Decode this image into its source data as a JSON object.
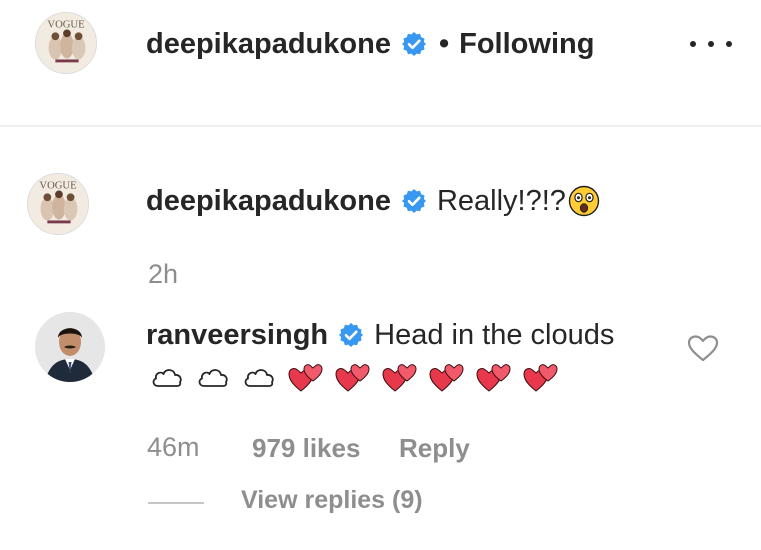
{
  "header": {
    "username": "deepikapadukone",
    "separator": "•",
    "follow_status": "Following",
    "avatar_caption": "VOGUE"
  },
  "comments": [
    {
      "username": "deepikapadukone",
      "text": "Really!?!?",
      "emoji": "astonished-face",
      "time": "2h",
      "avatar_caption": "VOGUE"
    },
    {
      "username": "ranveersingh",
      "text": "Head in the clouds",
      "emoji_row": [
        "cloud",
        "cloud",
        "cloud",
        "two-hearts",
        "two-hearts",
        "two-hearts",
        "two-hearts",
        "two-hearts",
        "two-hearts"
      ],
      "time": "46m",
      "likes": "979 likes",
      "reply_label": "Reply",
      "view_replies": "View replies (9)"
    }
  ],
  "colors": {
    "verified_badge": "#3897f0",
    "heart": "#e8384b",
    "muted_text": "#8e8e8e",
    "primary_text": "#262626"
  }
}
